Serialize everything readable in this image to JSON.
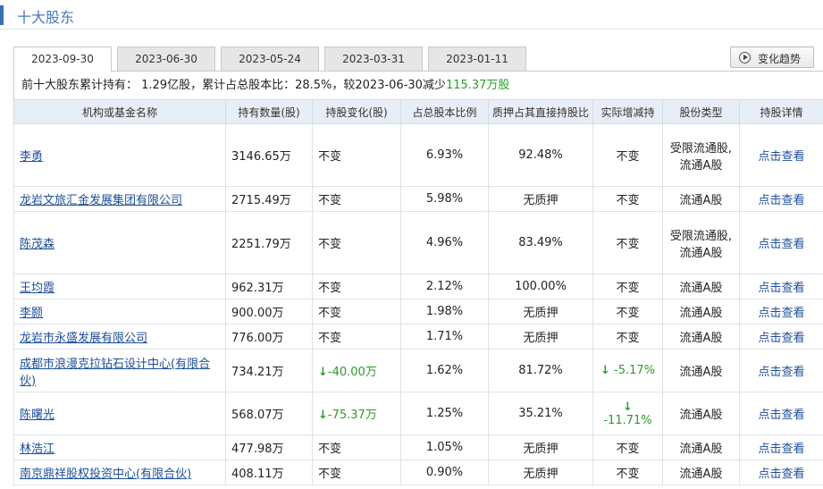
{
  "section_title": "十大股东",
  "tabs": [
    "2023-09-30",
    "2023-06-30",
    "2023-05-24",
    "2023-03-31",
    "2023-01-11"
  ],
  "active_tab": 0,
  "trend_button": "变化趋势",
  "summary": {
    "prefix": "前十大股东累计持有： 1.29亿股，累计占总股本比：28.5%，较2023-06-30减少",
    "change": "115.37万股"
  },
  "columns": [
    "机构或基金名称",
    "持有数量(股)",
    "持股变化(股)",
    "占总股本比例",
    "质押占其直接持股比",
    "实际增减持",
    "股份类型",
    "持股详情"
  ],
  "rows": [
    {
      "name": "李勇",
      "qty": "3146.65万",
      "change": "不变",
      "change_down": false,
      "ratio": "6.93%",
      "pledge": "92.48%",
      "actual": "不变",
      "actual_down": false,
      "type": "受限流通股,流通A股",
      "detail": "点击查看"
    },
    {
      "name": "龙岩文旅汇金发展集团有限公司",
      "qty": "2715.49万",
      "change": "不变",
      "change_down": false,
      "ratio": "5.98%",
      "pledge": "无质押",
      "actual": "不变",
      "actual_down": false,
      "type": "流通A股",
      "detail": "点击查看"
    },
    {
      "name": "陈茂森",
      "qty": "2251.79万",
      "change": "不变",
      "change_down": false,
      "ratio": "4.96%",
      "pledge": "83.49%",
      "actual": "不变",
      "actual_down": false,
      "type": "受限流通股,流通A股",
      "detail": "点击查看"
    },
    {
      "name": "王均霞",
      "qty": "962.31万",
      "change": "不变",
      "change_down": false,
      "ratio": "2.12%",
      "pledge": "100.00%",
      "actual": "不变",
      "actual_down": false,
      "type": "流通A股",
      "detail": "点击查看"
    },
    {
      "name": "李颢",
      "qty": "900.00万",
      "change": "不变",
      "change_down": false,
      "ratio": "1.98%",
      "pledge": "无质押",
      "actual": "不变",
      "actual_down": false,
      "type": "流通A股",
      "detail": "点击查看"
    },
    {
      "name": "龙岩市永盛发展有限公司",
      "qty": "776.00万",
      "change": "不变",
      "change_down": false,
      "ratio": "1.71%",
      "pledge": "无质押",
      "actual": "不变",
      "actual_down": false,
      "type": "流通A股",
      "detail": "点击查看"
    },
    {
      "name": "成都市浪漫克拉钻石设计中心(有限合伙)",
      "qty": "734.21万",
      "change": "-40.00万",
      "change_down": true,
      "ratio": "1.62%",
      "pledge": "81.72%",
      "actual": "-5.17%",
      "actual_down": true,
      "type": "流通A股",
      "detail": "点击查看"
    },
    {
      "name": "陈曙光",
      "qty": "568.07万",
      "change": "-75.37万",
      "change_down": true,
      "ratio": "1.25%",
      "pledge": "35.21%",
      "actual": "-11.71%",
      "actual_down": true,
      "type": "流通A股",
      "detail": "点击查看"
    },
    {
      "name": "林浩江",
      "qty": "477.98万",
      "change": "不变",
      "change_down": false,
      "ratio": "1.05%",
      "pledge": "无质押",
      "actual": "不变",
      "actual_down": false,
      "type": "流通A股",
      "detail": "点击查看"
    },
    {
      "name": "南京鼎祥股权投资中心(有限合伙)",
      "qty": "408.11万",
      "change": "不变",
      "change_down": false,
      "ratio": "0.90%",
      "pledge": "无质押",
      "actual": "不变",
      "actual_down": false,
      "type": "流通A股",
      "detail": "点击查看"
    }
  ]
}
